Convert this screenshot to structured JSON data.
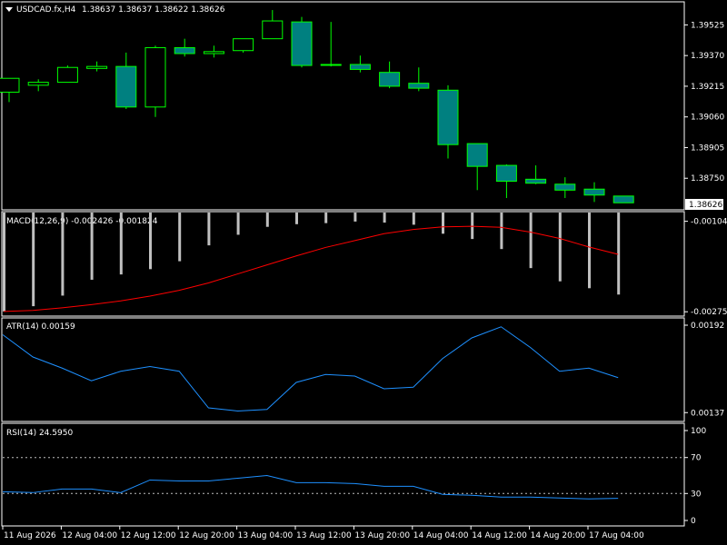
{
  "header": {
    "symbol": "USDCAD.fx,H4",
    "ohlc": "1.38637 1.38637 1.38622 1.38626",
    "current_price": "1.38626"
  },
  "colors": {
    "background": "#000000",
    "frame": "#ffffff",
    "bull_body": "#000000",
    "bear_body": "#008080",
    "candle_outline": "#00ff00",
    "macd_hist": "#c0c0c0",
    "macd_signal": "#ff0000",
    "atr_line": "#1e90ff",
    "rsi_line": "#1e90ff",
    "price_tag_bg": "#ffffff",
    "price_tag_text": "#000000"
  },
  "chart_data": [
    {
      "type": "candlestick",
      "title": "USDCAD.fx,H4",
      "yticks": [
        "1.39525",
        "1.39370",
        "1.39215",
        "1.39060",
        "1.38905",
        "1.38750"
      ],
      "ylim": [
        1.38595,
        1.39637
      ],
      "candles": [
        {
          "o": 1.39185,
          "h": 1.3923,
          "l": 1.39135,
          "c": 1.39255
        },
        {
          "o": 1.3922,
          "h": 1.3925,
          "l": 1.3919,
          "c": 1.39235
        },
        {
          "o": 1.39235,
          "h": 1.3932,
          "l": 1.39235,
          "c": 1.3931
        },
        {
          "o": 1.39305,
          "h": 1.3934,
          "l": 1.3929,
          "c": 1.39315
        },
        {
          "o": 1.39315,
          "h": 1.39385,
          "l": 1.391,
          "c": 1.3911
        },
        {
          "o": 1.3911,
          "h": 1.3942,
          "l": 1.3906,
          "c": 1.3941
        },
        {
          "o": 1.3941,
          "h": 1.39455,
          "l": 1.39365,
          "c": 1.3938
        },
        {
          "o": 1.3938,
          "h": 1.3942,
          "l": 1.3936,
          "c": 1.3939
        },
        {
          "o": 1.39395,
          "h": 1.3945,
          "l": 1.39385,
          "c": 1.39455
        },
        {
          "o": 1.39455,
          "h": 1.396,
          "l": 1.39455,
          "c": 1.39545
        },
        {
          "o": 1.3954,
          "h": 1.39565,
          "l": 1.3931,
          "c": 1.3932
        },
        {
          "o": 1.39325,
          "h": 1.3954,
          "l": 1.39315,
          "c": 1.39325
        },
        {
          "o": 1.39325,
          "h": 1.3937,
          "l": 1.39285,
          "c": 1.393
        },
        {
          "o": 1.39285,
          "h": 1.3934,
          "l": 1.39205,
          "c": 1.39215
        },
        {
          "o": 1.3923,
          "h": 1.3931,
          "l": 1.3919,
          "c": 1.39205
        },
        {
          "o": 1.39195,
          "h": 1.3922,
          "l": 1.3885,
          "c": 1.3892
        },
        {
          "o": 1.38925,
          "h": 1.38925,
          "l": 1.3869,
          "c": 1.3881
        },
        {
          "o": 1.38815,
          "h": 1.3882,
          "l": 1.3865,
          "c": 1.38735
        },
        {
          "o": 1.38745,
          "h": 1.38815,
          "l": 1.3872,
          "c": 1.38725
        },
        {
          "o": 1.3872,
          "h": 1.38755,
          "l": 1.3865,
          "c": 1.3869
        },
        {
          "o": 1.38695,
          "h": 1.3873,
          "l": 1.3863,
          "c": 1.38665
        },
        {
          "o": 1.3866,
          "h": 1.3866,
          "l": 1.3864,
          "c": 1.38626
        }
      ]
    },
    {
      "type": "bar",
      "title": "MACD(12,26,9) -0.002426 -0.001824",
      "yticks": [
        "-0.001045",
        "-0.002755"
      ],
      "ylim": [
        -0.00282,
        -0.00088
      ],
      "histogram": [
        -0.00275,
        -0.00265,
        -0.00245,
        -0.00215,
        -0.00205,
        -0.00195,
        -0.0018,
        -0.0015,
        -0.0013,
        -0.00115,
        -0.0011,
        -0.00108,
        -0.00105,
        -0.00107,
        -0.00111,
        -0.00128,
        -0.00138,
        -0.00157,
        -0.00193,
        -0.00218,
        -0.00231,
        -0.00243
      ],
      "signal": [
        -0.00275,
        -0.00273,
        -0.00268,
        -0.00262,
        -0.00255,
        -0.00246,
        -0.00235,
        -0.00221,
        -0.00204,
        -0.00187,
        -0.0017,
        -0.00154,
        -0.00141,
        -0.00128,
        -0.0012,
        -0.00115,
        -0.00114,
        -0.00116,
        -0.00125,
        -0.00137,
        -0.00153,
        -0.00167
      ]
    },
    {
      "type": "line",
      "title": "ATR(14) 0.00159",
      "yticks": [
        "0.00192",
        "0.00137"
      ],
      "ylim": [
        0.00132,
        0.00196
      ],
      "values": [
        0.00186,
        0.00172,
        0.00165,
        0.00157,
        0.00163,
        0.00166,
        0.00163,
        0.0014,
        0.00138,
        0.00139,
        0.00156,
        0.00161,
        0.0016,
        0.00152,
        0.00153,
        0.00171,
        0.00184,
        0.00191,
        0.00178,
        0.00163,
        0.00165,
        0.00159
      ]
    },
    {
      "type": "line",
      "title": "RSI(14) 24.5950",
      "yticks": [
        "100",
        "70",
        "30",
        "0"
      ],
      "levels": [
        70,
        30
      ],
      "ylim": [
        0,
        100
      ],
      "values": [
        32,
        31,
        35,
        35,
        31,
        45,
        44,
        44,
        47,
        50,
        42,
        42,
        41,
        38,
        38,
        29,
        28,
        26,
        26,
        25,
        24,
        24.6
      ]
    }
  ],
  "x_axis": {
    "labels": [
      "11 Aug 2026",
      "12 Aug 04:00",
      "12 Aug 12:00",
      "12 Aug 20:00",
      "13 Aug 04:00",
      "13 Aug 12:00",
      "13 Aug 20:00",
      "14 Aug 04:00",
      "14 Aug 12:00",
      "14 Aug 20:00",
      "17 Aug 04:00"
    ]
  }
}
